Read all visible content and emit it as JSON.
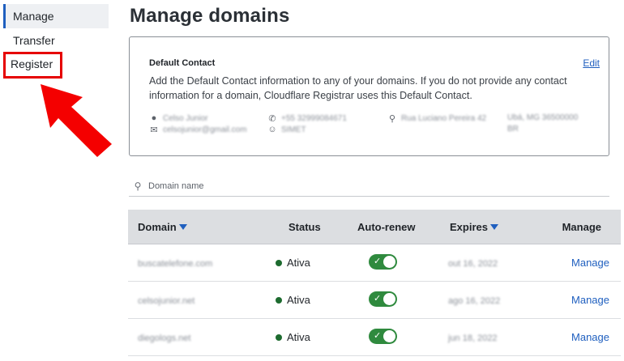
{
  "sidebar": {
    "items": [
      {
        "label": "Manage",
        "active": true
      },
      {
        "label": "Transfer",
        "active": false
      },
      {
        "label": "Register",
        "active": false,
        "highlighted": true
      }
    ]
  },
  "page": {
    "title": "Manage domains"
  },
  "contact_card": {
    "heading": "Default Contact",
    "edit_label": "Edit",
    "description": "Add the Default Contact information to any of your domains. If you do not provide any contact information for a domain, Cloudflare Registrar uses this Default Contact.",
    "name": "Celso Junior",
    "email": "celsojunior@gmail.com",
    "phone": "+55 32999084671",
    "org": "SIMET",
    "address": "Rua Luciano Pereira 42",
    "city": "Ubá, MG 36500000",
    "country": "BR"
  },
  "search": {
    "placeholder": "Domain name"
  },
  "table": {
    "headers": {
      "domain": "Domain",
      "status": "Status",
      "auto_renew": "Auto-renew",
      "expires": "Expires",
      "manage": "Manage"
    },
    "rows": [
      {
        "domain": "buscatelefone.com",
        "status": "Ativa",
        "auto_renew": true,
        "expires": "out 16, 2022",
        "manage": "Manage"
      },
      {
        "domain": "celsojunior.net",
        "status": "Ativa",
        "auto_renew": true,
        "expires": "ago 16, 2022",
        "manage": "Manage"
      },
      {
        "domain": "diegologs.net",
        "status": "Ativa",
        "auto_renew": true,
        "expires": "jun 18, 2022",
        "manage": "Manage"
      }
    ]
  },
  "colors": {
    "accent": "#1f5fbf",
    "highlight": "#e60000",
    "toggle_on": "#2f8a3e",
    "status_active": "#1d6b2f",
    "header_bg": "#dcdee1"
  },
  "icons": {
    "search": "search-icon",
    "person": "person-icon",
    "mail": "mail-icon",
    "phone": "phone-icon",
    "org": "org-icon",
    "location": "location-icon",
    "sort": "sort-desc-icon",
    "annotation": "red-arrow-icon"
  }
}
